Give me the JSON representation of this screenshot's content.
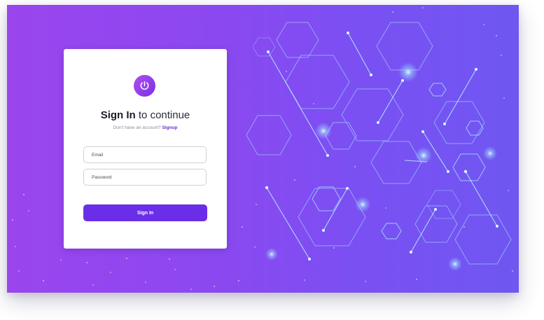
{
  "heading": {
    "bold": "Sign In",
    "rest": " to continue"
  },
  "subheading": {
    "prompt": "Don't have an account?",
    "link": "Signup"
  },
  "form": {
    "email_label": "Email",
    "password_label": "Password",
    "submit_label": "Sign In"
  },
  "colors": {
    "accent": "#6a2ee8",
    "background_start": "#9a45ee",
    "background_end": "#6f57f1"
  },
  "icons": {
    "logo": "power-icon"
  }
}
